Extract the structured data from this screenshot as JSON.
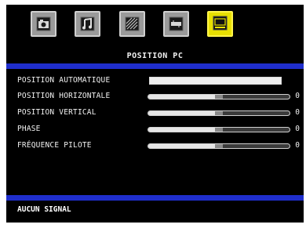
{
  "menu": {
    "title": "POSITION PC",
    "icons": [
      {
        "name": "picture-icon",
        "active": false
      },
      {
        "name": "sound-icon",
        "active": false
      },
      {
        "name": "feature-icon",
        "active": false
      },
      {
        "name": "install-icon",
        "active": false
      },
      {
        "name": "pc-position-icon",
        "active": true
      }
    ]
  },
  "items": [
    {
      "label": "POSITION AUTOMATIQUE",
      "type": "action"
    },
    {
      "label": "POSITION HORIZONTALE",
      "type": "slider",
      "value": "0",
      "level": 0.5
    },
    {
      "label": "POSITION VERTICAL",
      "type": "slider",
      "value": "0",
      "level": 0.5
    },
    {
      "label": "PHASE",
      "type": "slider",
      "value": "0",
      "level": 0.5
    },
    {
      "label": "FRÉQUENCE PILOTE",
      "type": "slider",
      "value": "0",
      "level": 0.5
    }
  ],
  "status": "AUCUN SIGNAL",
  "colors": {
    "accent": "#1f2ecc",
    "active_icon": "#e8e000",
    "background": "#000000"
  }
}
